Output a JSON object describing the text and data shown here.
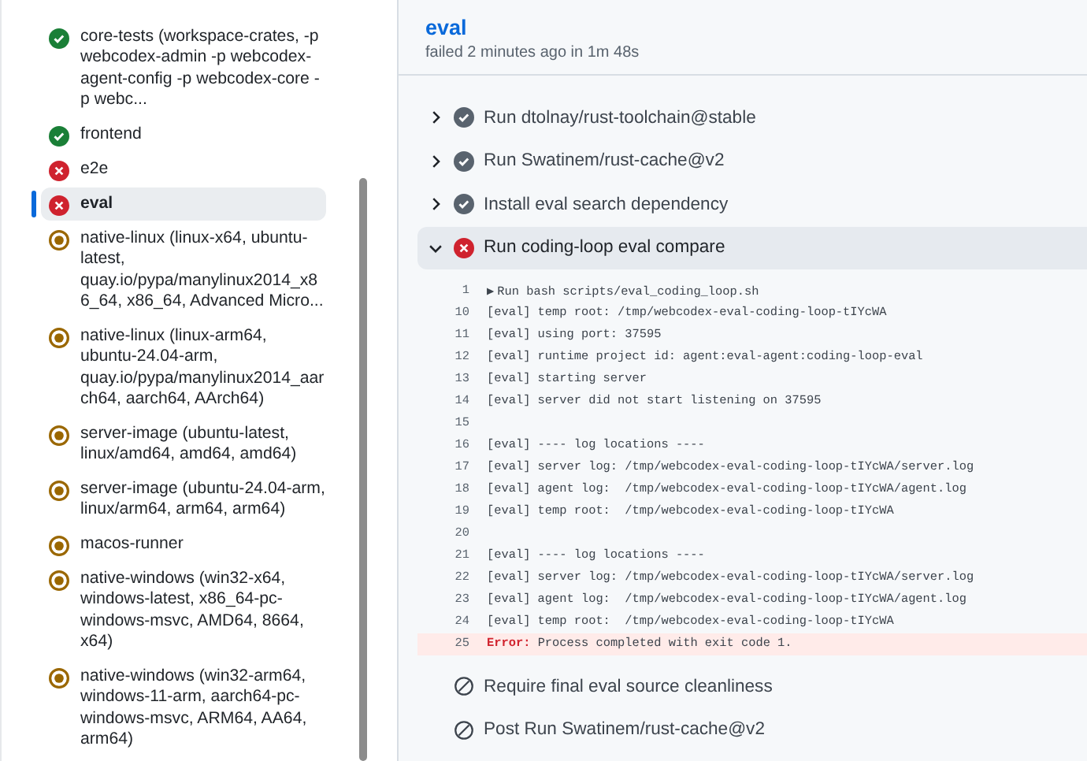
{
  "sidebar": {
    "jobs": [
      {
        "name": "core-tests (workspace-crates, -p webcodex-admin -p webcodex-agent-config -p webcodex-core -p webc...",
        "kind": "success",
        "selected": false
      },
      {
        "name": "frontend",
        "kind": "success",
        "selected": false
      },
      {
        "name": "e2e",
        "kind": "failure",
        "selected": false
      },
      {
        "name": "eval",
        "kind": "failure",
        "selected": true
      },
      {
        "name": "native-linux (linux-x64, ubuntu-latest, quay.io/pypa/manylinux2014_x86_64, x86_64, Advanced Micro...",
        "kind": "queued",
        "selected": false
      },
      {
        "name": "native-linux (linux-arm64, ubuntu-24.04-arm, quay.io/pypa/manylinux2014_aarch64, aarch64, AArch64)",
        "kind": "queued",
        "selected": false
      },
      {
        "name": "server-image (ubuntu-latest, linux/amd64, amd64, amd64)",
        "kind": "queued",
        "selected": false
      },
      {
        "name": "server-image (ubuntu-24.04-arm, linux/arm64, arm64, arm64)",
        "kind": "queued",
        "selected": false
      },
      {
        "name": "macos-runner",
        "kind": "queued",
        "selected": false
      },
      {
        "name": "native-windows (win32-x64, windows-latest, x86_64-pc-windows-msvc, AMD64, 8664, x64)",
        "kind": "queued",
        "selected": false
      },
      {
        "name": "native-windows (win32-arm64, windows-11-arm, aarch64-pc-windows-msvc, ARM64, AA64, arm64)",
        "kind": "queued",
        "selected": false
      }
    ]
  },
  "job": {
    "title": "eval",
    "summary": "failed 2 minutes ago in 1m 48s"
  },
  "steps": [
    {
      "name": "Run dtolnay/rust-toolchain@stable",
      "kind": "success",
      "expanded": false
    },
    {
      "name": "Run Swatinem/rust-cache@v2",
      "kind": "success",
      "expanded": false
    },
    {
      "name": "Install eval search dependency",
      "kind": "success",
      "expanded": false
    },
    {
      "name": "Run coding-loop eval compare",
      "kind": "failure",
      "expanded": true,
      "log": [
        {
          "number": "1",
          "kind": "group",
          "marker": "▶",
          "text": "Run bash scripts/eval_coding_loop.sh"
        },
        {
          "number": "10",
          "kind": "plain",
          "text": "[eval] temp root: /tmp/webcodex-eval-coding-loop-tIYcWA"
        },
        {
          "number": "11",
          "kind": "plain",
          "text": "[eval] using port: 37595"
        },
        {
          "number": "12",
          "kind": "plain",
          "text": "[eval] runtime project id: agent:eval-agent:coding-loop-eval"
        },
        {
          "number": "13",
          "kind": "plain",
          "text": "[eval] starting server"
        },
        {
          "number": "14",
          "kind": "plain",
          "text": "[eval] server did not start listening on 37595"
        },
        {
          "number": "15",
          "kind": "plain"
        },
        {
          "number": "16",
          "kind": "plain",
          "text": "[eval] ---- log locations ----"
        },
        {
          "number": "17",
          "kind": "plain",
          "text": "[eval] server log: /tmp/webcodex-eval-coding-loop-tIYcWA/server.log"
        },
        {
          "number": "18",
          "kind": "plain",
          "text": "[eval] agent log:  /tmp/webcodex-eval-coding-loop-tIYcWA/agent.log"
        },
        {
          "number": "19",
          "kind": "plain",
          "text": "[eval] temp root:  /tmp/webcodex-eval-coding-loop-tIYcWA"
        },
        {
          "number": "20",
          "kind": "plain"
        },
        {
          "number": "21",
          "kind": "plain",
          "text": "[eval] ---- log locations ----"
        },
        {
          "number": "22",
          "kind": "plain",
          "text": "[eval] server log: /tmp/webcodex-eval-coding-loop-tIYcWA/server.log"
        },
        {
          "number": "23",
          "kind": "plain",
          "text": "[eval] agent log:  /tmp/webcodex-eval-coding-loop-tIYcWA/agent.log"
        },
        {
          "number": "24",
          "kind": "plain",
          "text": "[eval] temp root:  /tmp/webcodex-eval-coding-loop-tIYcWA"
        },
        {
          "number": "25",
          "kind": "error",
          "label": "Error:",
          "text": "Process completed with exit code 1."
        }
      ]
    },
    {
      "name": "Require final eval source cleanliness",
      "kind": "skipped",
      "expanded": false
    },
    {
      "name": "Post Run Swatinem/rust-cache@v2",
      "kind": "skipped",
      "expanded": false
    }
  ]
}
